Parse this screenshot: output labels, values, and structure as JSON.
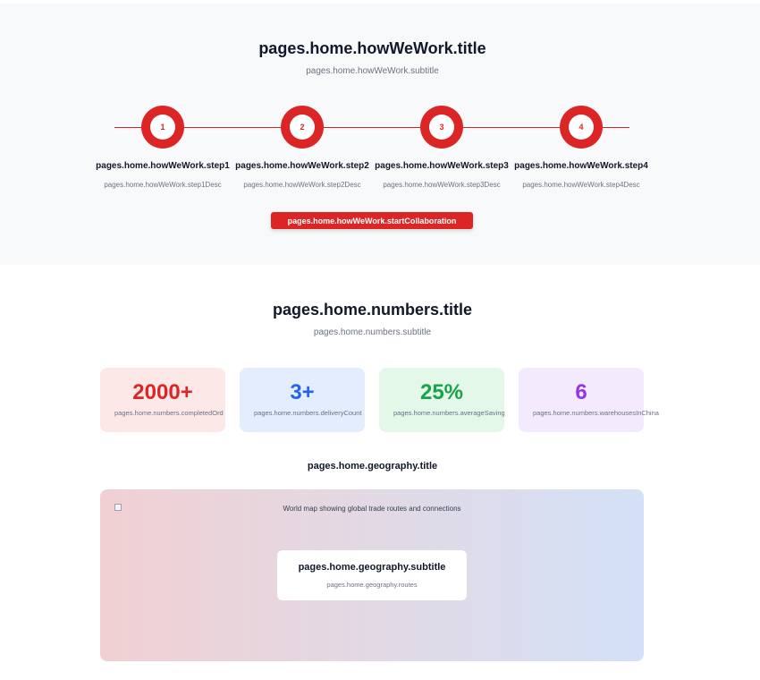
{
  "howWeWork": {
    "title": "pages.home.howWeWork.title",
    "subtitle": "pages.home.howWeWork.subtitle",
    "steps": [
      {
        "number": "1",
        "label": "pages.home.howWeWork.step1",
        "desc": "pages.home.howWeWork.step1Desc"
      },
      {
        "number": "2",
        "label": "pages.home.howWeWork.step2",
        "desc": "pages.home.howWeWork.step2Desc"
      },
      {
        "number": "3",
        "label": "pages.home.howWeWork.step3",
        "desc": "pages.home.howWeWork.step3Desc"
      },
      {
        "number": "4",
        "label": "pages.home.howWeWork.step4",
        "desc": "pages.home.howWeWork.step4Desc"
      }
    ],
    "cta_label": "pages.home.howWeWork.startCollaboration",
    "accent_color": "#dc2626"
  },
  "numbers": {
    "title": "pages.home.numbers.title",
    "subtitle": "pages.home.numbers.subtitle",
    "stats": [
      {
        "value": "2000+",
        "label": "pages.home.numbers.completedOrd",
        "color": "#dc2626",
        "bg": "#fde8e8"
      },
      {
        "value": "3+",
        "label": "pages.home.numbers.deliveryCount",
        "color": "#2563eb",
        "bg": "#e3edfd"
      },
      {
        "value": "25%",
        "label": "pages.home.numbers.averageSaving",
        "color": "#16a34a",
        "bg": "#e4f8ea"
      },
      {
        "value": "6",
        "label": "pages.home.numbers.warehousesInChina",
        "color": "#9333ea",
        "bg": "#f3eafd"
      }
    ]
  },
  "geography": {
    "title": "pages.home.geography.title",
    "map_alt": "World map showing global trade routes and connections",
    "subtitle": "pages.home.geography.subtitle",
    "routes": "pages.home.geography.routes"
  }
}
